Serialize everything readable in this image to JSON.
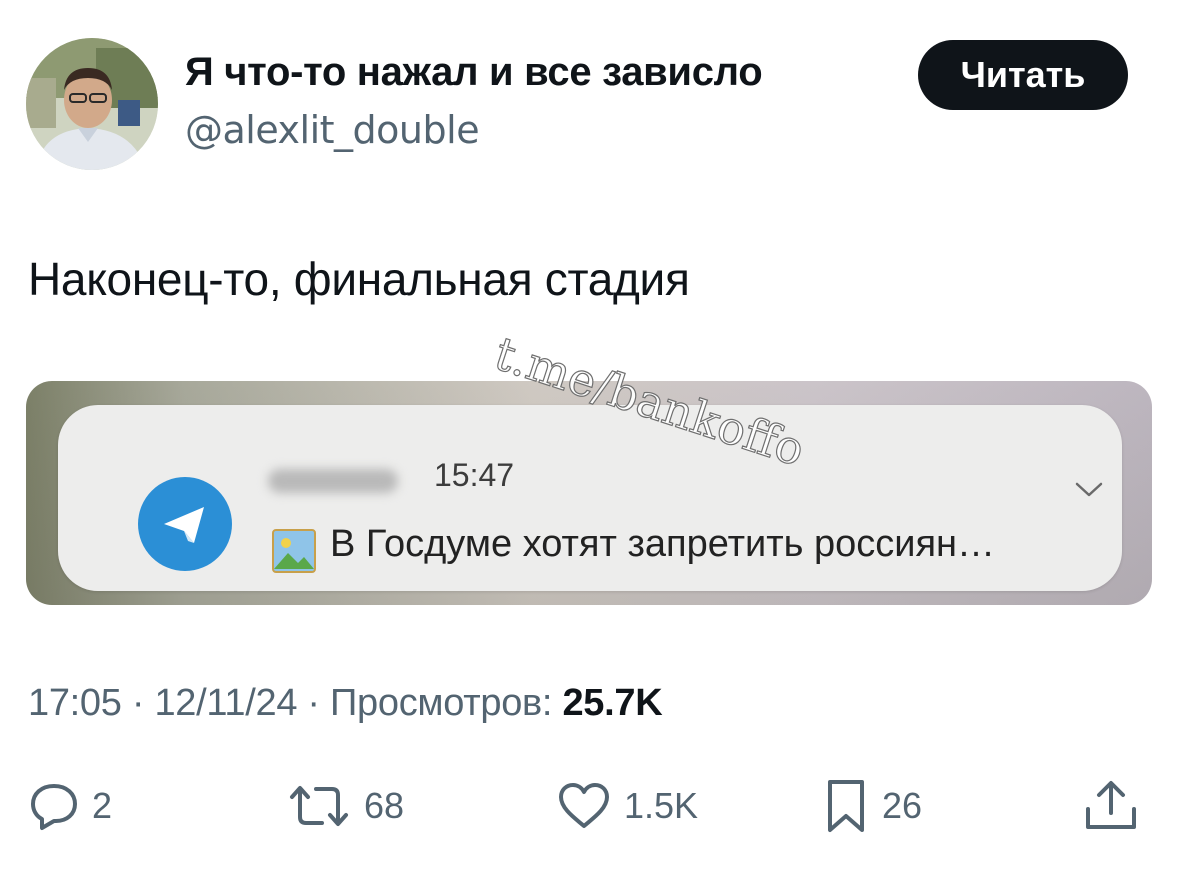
{
  "author": {
    "display_name": "Я что-то нажал и все зависло",
    "handle": "@alexlit_double"
  },
  "read_button_label": "Читать",
  "tweet_text": "Наконец-то, финальная стадия",
  "watermark": "t.me/bankoffo",
  "media": {
    "notification": {
      "app_icon": "telegram-icon",
      "time": "15:47",
      "preview_icon": "picture-icon",
      "preview_text": "В Госдуме хотят запретить россиян…"
    }
  },
  "meta": {
    "time": "17:05",
    "separator": " · ",
    "date": "12/11/24",
    "views_label": "Просмотров:",
    "views_count": "25.7K"
  },
  "actions": {
    "replies": "2",
    "reposts": "68",
    "likes": "1.5K",
    "bookmarks": "26"
  },
  "colors": {
    "text_primary": "#0f1419",
    "text_secondary": "#536471",
    "button_bg": "#0f1419",
    "telegram_blue": "#2b8fd6"
  }
}
